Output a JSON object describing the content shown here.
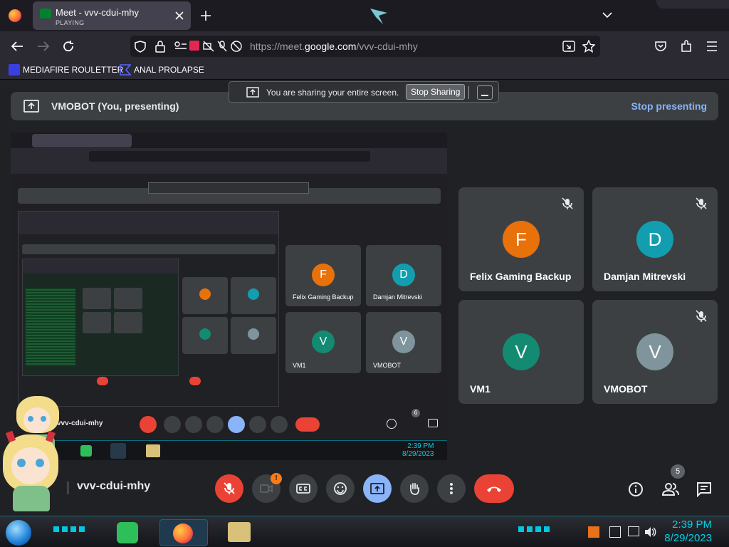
{
  "browser": {
    "tab_title": "Meet - vvv-cdui-mhy",
    "tab_subtitle": "PLAYING",
    "url_prefix": "https://meet.",
    "url_domain": "google.com",
    "url_path": "/vvv-cdui-mhy",
    "bookmarks": [
      "MEDIAFIRE ROULETTER",
      "ANAL PROLAPSE"
    ]
  },
  "share_notice": {
    "message": "You are sharing your entire screen.",
    "stop_label": "Stop Sharing"
  },
  "presenting": {
    "title": "VMOBOT (You, presenting)",
    "stop_label": "Stop presenting"
  },
  "participants": [
    {
      "initial": "F",
      "name": "Felix Gaming Backup",
      "color": "#e8710a"
    },
    {
      "initial": "D",
      "name": "Damjan Mitrevski",
      "color": "#129eaf"
    },
    {
      "initial": "V",
      "name": "VM1",
      "color": "#138a72"
    },
    {
      "initial": "V",
      "name": "VMOBOT",
      "color": "#7f949c"
    }
  ],
  "controls": {
    "meeting_code": "vvv-cdui-mhy",
    "camera_badge": "!",
    "people_count": "5"
  },
  "taskbar": {
    "time": "2:39 PM",
    "date": "8/29/2023"
  },
  "preview_inner": {
    "time": "2:39 PM",
    "date": "8/29/2023",
    "people_count": "6"
  },
  "colors": {
    "accent_blue": "#8ab4f8",
    "end_call_red": "#ea4335",
    "tile_bg": "#3c4043"
  }
}
